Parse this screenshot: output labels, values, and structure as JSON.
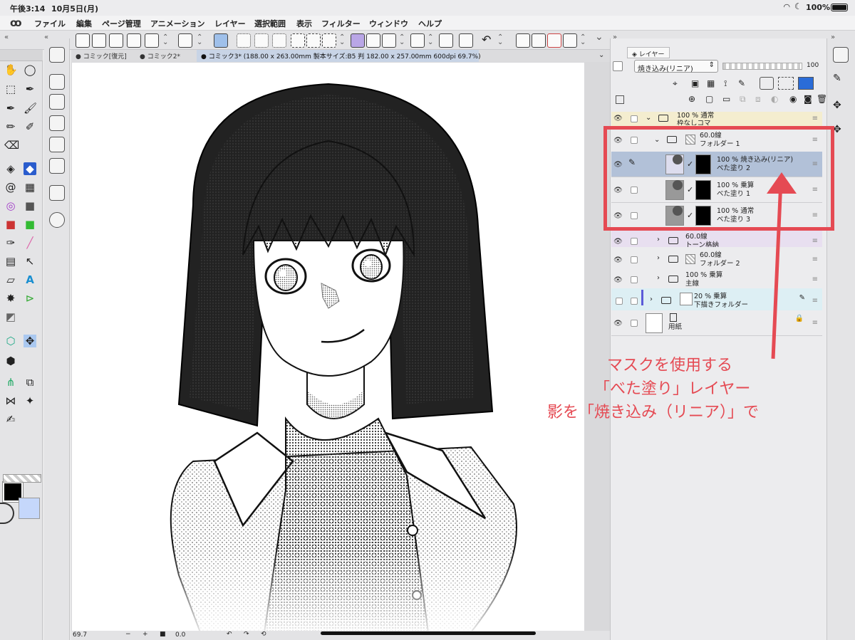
{
  "status": {
    "time": "午後3:14",
    "date": "10月5日(月)",
    "battery": "100%"
  },
  "menu": {
    "items": [
      "ファイル",
      "編集",
      "ページ管理",
      "アニメーション",
      "レイヤー",
      "選択範囲",
      "表示",
      "フィルター",
      "ウィンドウ",
      "ヘルプ"
    ]
  },
  "tabs": [
    {
      "label": "● コミック[復元]"
    },
    {
      "label": "● コミック2*"
    },
    {
      "label": "● コミック3* (188.00 x 263.00mm 製本サイズ:B5 判 182.00 x 257.00mm 600dpi 69.7%)"
    }
  ],
  "layer_panel": {
    "tab_label": "レイヤー",
    "blend_mode": "焼き込み(リニア)",
    "opacity_value": "100",
    "layers": [
      {
        "line1": "100 % 通常",
        "line2": "枠なしコマ"
      },
      {
        "line1": "60.0線",
        "line2": "フォルダー 1"
      },
      {
        "line1": "100 % 焼き込み(リニア)",
        "line2": "べた塗り 2"
      },
      {
        "line1": "100 % 乗算",
        "line2": "べた塗り 1"
      },
      {
        "line1": "100 % 通常",
        "line2": "べた塗り 3"
      },
      {
        "line1": "60.0線",
        "line2": "トーン格納"
      },
      {
        "line1": "60.0線",
        "line2": "フォルダー 2"
      },
      {
        "line1": "100 % 乗算",
        "line2": "主線"
      },
      {
        "line1": "20 % 乗算",
        "line2": "下描きフォルダー"
      },
      {
        "line1": "",
        "line2": "用紙"
      }
    ]
  },
  "annotation": {
    "line1": "マスクを使用する",
    "line2": "「べた塗り」レイヤー",
    "line3": "影を「焼き込み（リニア）」で"
  },
  "bottom": {
    "zoom": "69.7",
    "angle": "0.0"
  },
  "colors": {
    "accent_red": "#e54a53",
    "selected_row": "#b2c1d8",
    "sub_color": "#c5d7fb"
  },
  "icons": [
    "clip-studio-logo",
    "pen-icon",
    "move-icon",
    "lasso-icon",
    "select-rect-icon",
    "eyedropper-icon",
    "brush-icon",
    "eraser-icon",
    "fill-icon",
    "gradient-icon",
    "text-icon",
    "eye-icon",
    "folder-icon",
    "lock-icon",
    "undo-icon",
    "redo-icon"
  ]
}
